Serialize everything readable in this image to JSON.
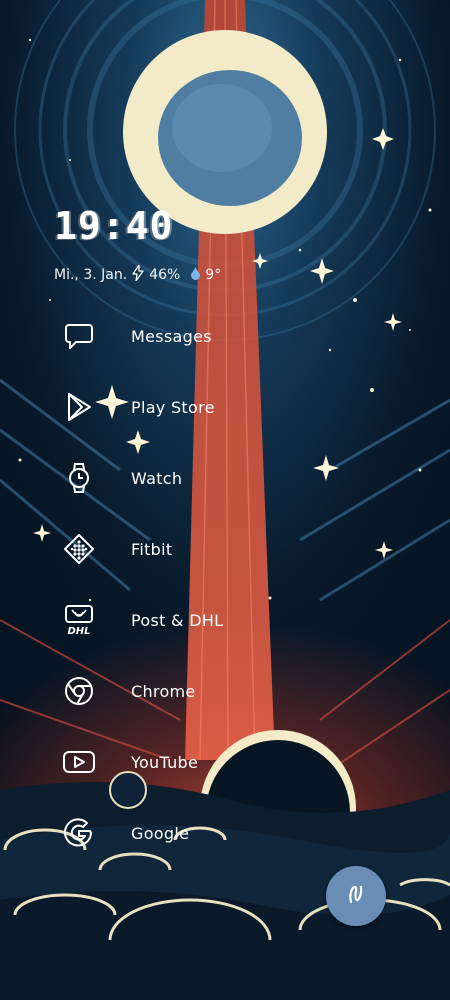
{
  "clock": {
    "time": "19:40"
  },
  "status": {
    "date": "Mi., 3. Jan.",
    "battery": "46%",
    "temperature": "9°"
  },
  "apps": [
    {
      "label": "Messages",
      "icon": "messages-icon"
    },
    {
      "label": "Play Store",
      "icon": "play-store-icon"
    },
    {
      "label": "Watch",
      "icon": "watch-icon"
    },
    {
      "label": "Fitbit",
      "icon": "fitbit-icon"
    },
    {
      "label": "Post & DHL",
      "icon": "post-dhl-icon"
    },
    {
      "label": "Chrome",
      "icon": "chrome-icon"
    },
    {
      "label": "YouTube",
      "icon": "youtube-icon"
    },
    {
      "label": "Google",
      "icon": "google-icon"
    }
  ],
  "fab": {
    "icon": "launcher-logo-icon"
  },
  "colors": {
    "sky_dark": "#071827",
    "sky_blue": "#1d4f73",
    "moon": "#f3ebc8",
    "moon_blue": "#4f7ea2",
    "beam_red": "#e0503a",
    "fab": "#6a8db6"
  }
}
